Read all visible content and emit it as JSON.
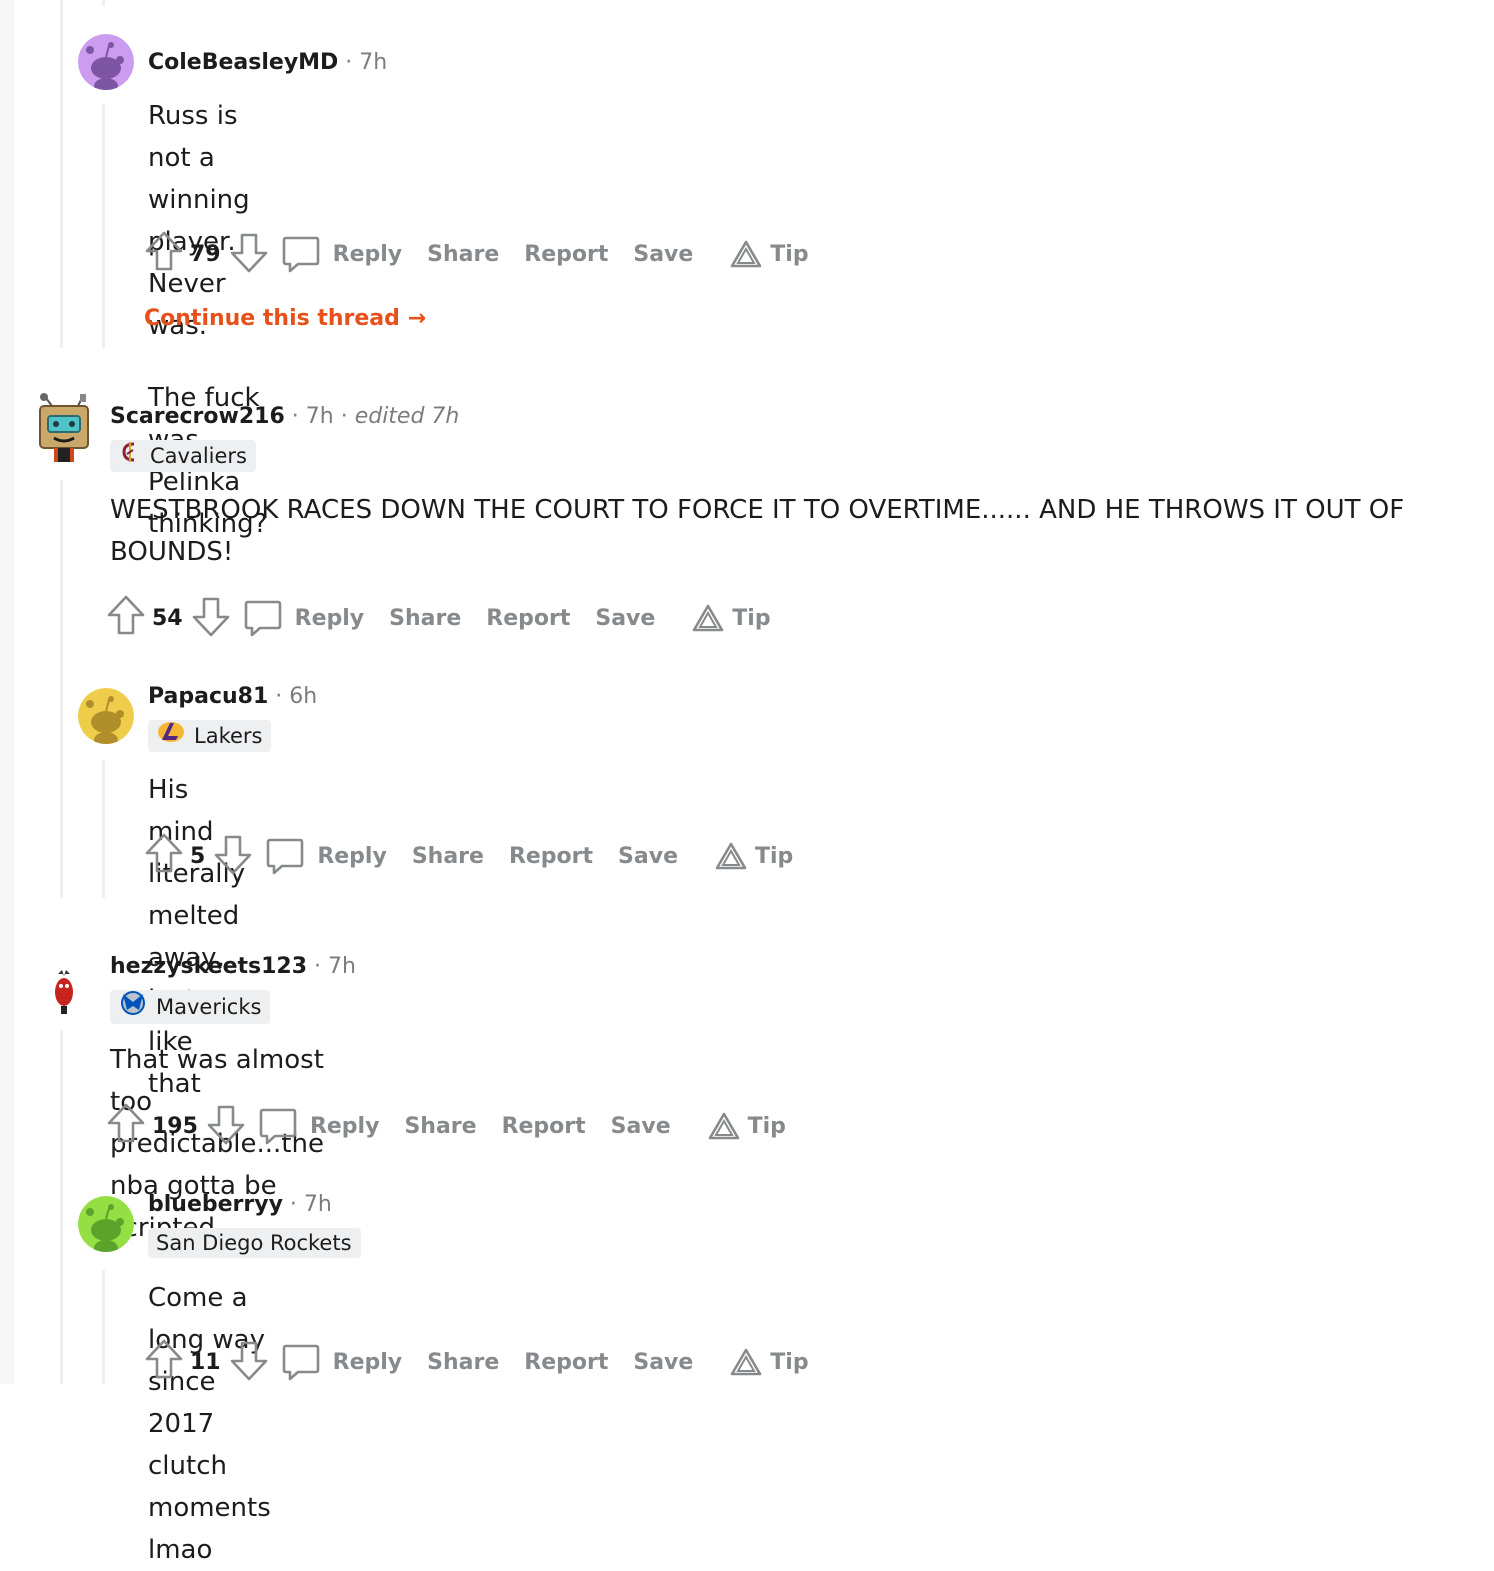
{
  "actions": {
    "reply": "Reply",
    "share": "Share",
    "report": "Report",
    "save": "Save",
    "tip": "Tip"
  },
  "comments": [
    {
      "username": "ColeBeasleyMD",
      "time": "7h",
      "avatar_color": "#cc9cf1",
      "body": [
        "Russ is not a winning player. Never was.",
        "The fuck was Pelinka thinking?"
      ],
      "score": "79",
      "continue_label": "Continue this thread"
    },
    {
      "username": "Scarecrow216",
      "time": "7h",
      "edited": "edited 7h",
      "flair": "Cavaliers",
      "flair_icon": "cavaliers-logo-icon",
      "body": [
        "WESTBROOK RACES DOWN THE COURT TO FORCE IT TO OVERTIME...... AND HE THROWS IT OUT OF BOUNDS!"
      ],
      "score": "54"
    },
    {
      "username": "Papacu81",
      "time": "6h",
      "avatar_color": "#f0cc4b",
      "flair": "Lakers",
      "flair_icon": "lakers-logo-icon",
      "body": [
        "His mind literally melted away, just like that"
      ],
      "score": "5"
    },
    {
      "username": "hezzyskeets123",
      "time": "7h",
      "flair": "Mavericks",
      "flair_icon": "mavericks-logo-icon",
      "body": [
        "That was almost too predictable...the nba gotta be scripted"
      ],
      "score": "195"
    },
    {
      "username": "blueberryy",
      "time": "7h",
      "avatar_color": "#94e044",
      "flair": "San Diego Rockets",
      "body": [
        "Come a long way since 2017 clutch moments lmao"
      ],
      "score": "11"
    }
  ],
  "colors": {
    "accent": "#e5501b",
    "meta_gray": "#7c7c7c",
    "action_gray": "#878a8c",
    "flair_bg": "#edeff1",
    "thread_line": "#edeff1"
  }
}
